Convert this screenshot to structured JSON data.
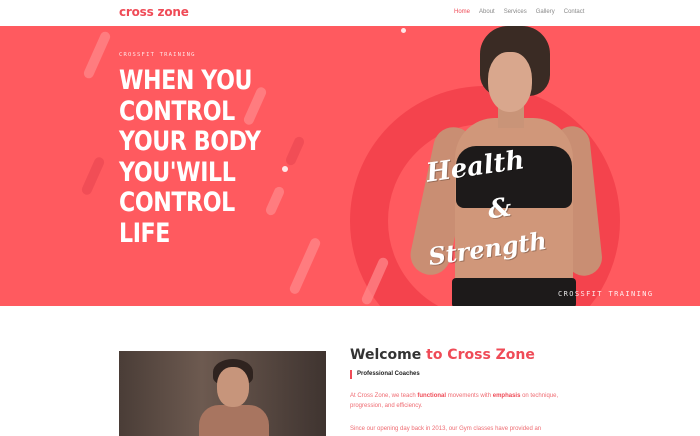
{
  "header": {
    "logo": "cross zone",
    "nav": [
      {
        "label": "Home",
        "active": true
      },
      {
        "label": "About",
        "active": false
      },
      {
        "label": "Services",
        "active": false
      },
      {
        "label": "Gallery",
        "active": false
      },
      {
        "label": "Contact",
        "active": false
      }
    ]
  },
  "hero": {
    "subtitle": "CROSSFIT TRAINING",
    "headline": [
      "WHEN YOU",
      "CONTROL",
      "YOUR BODY",
      "YOU'WILL",
      "CONTROL",
      "LIFE"
    ],
    "brush_lines": [
      "Health",
      "&",
      "Strength"
    ],
    "tag": "CROSSFIT TRAINING"
  },
  "welcome": {
    "title_prefix": "Welcome ",
    "title_accent": "to Cross Zone",
    "label": "Professional Coaches",
    "p1_a": "At Cross Zone, we teach ",
    "p1_b": "functional",
    "p1_c": " movements with ",
    "p1_d": "emphasis",
    "p1_e": " on technique, progression, and efficiency.",
    "p2": "Since our opening day back in 2013, our Gym classes have provided an"
  },
  "colors": {
    "accent": "#ef4b57",
    "hero_bg": "#ff5a5f"
  }
}
